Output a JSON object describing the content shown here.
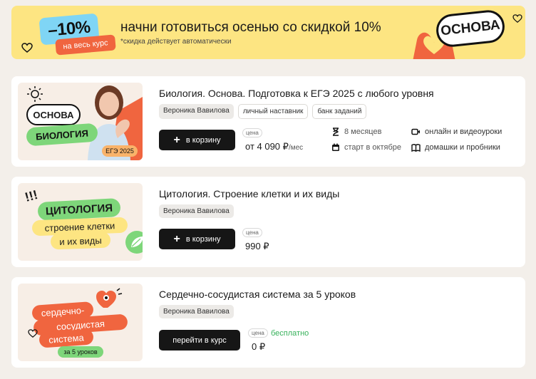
{
  "promo": {
    "discount": "–10%",
    "discount_tag": "на весь курс",
    "headline": "начни готовиться осенью со скидкой 10%",
    "footnote": "*скидка действует автоматически",
    "bubble": "ОСНОВА"
  },
  "courses": [
    {
      "title": "Биология. Основа. Подготовка к ЕГЭ 2025 с любого уровня",
      "chips": [
        "Вероника Вавилова",
        "личный наставник",
        "банк заданий"
      ],
      "button": "в корзину",
      "price_label": "цена",
      "price": "от 4 090 ₽",
      "price_suffix": "/мес",
      "features": [
        "8 месяцев",
        "онлайн и видеоуроки",
        "старт в октябре",
        "домашки и пробники"
      ],
      "thumb": {
        "line1": "ОСНОВА",
        "line2": "БИОЛОГИЯ",
        "badge": "ЕГЭ 2025"
      }
    },
    {
      "title": "Цитология. Строение клетки и их виды",
      "chips": [
        "Вероника Вавилова"
      ],
      "button": "в корзину",
      "price_label": "цена",
      "price": "990 ₽",
      "thumb": {
        "marks": "!!!",
        "line1": "ЦИТОЛОГИЯ",
        "line2": "строение клетки",
        "line3": "и их виды"
      }
    },
    {
      "title": "Сердечно-сосудистая система за 5 уроков",
      "chips": [
        "Вероника Вавилова"
      ],
      "button": "перейти в курс",
      "price_label": "цена",
      "price": "0 ₽",
      "free_label": "бесплатно",
      "thumb": {
        "line1": "сердечно-",
        "line2": "сосудистая",
        "line3": "система",
        "badge": "за 5 уроков"
      }
    }
  ]
}
